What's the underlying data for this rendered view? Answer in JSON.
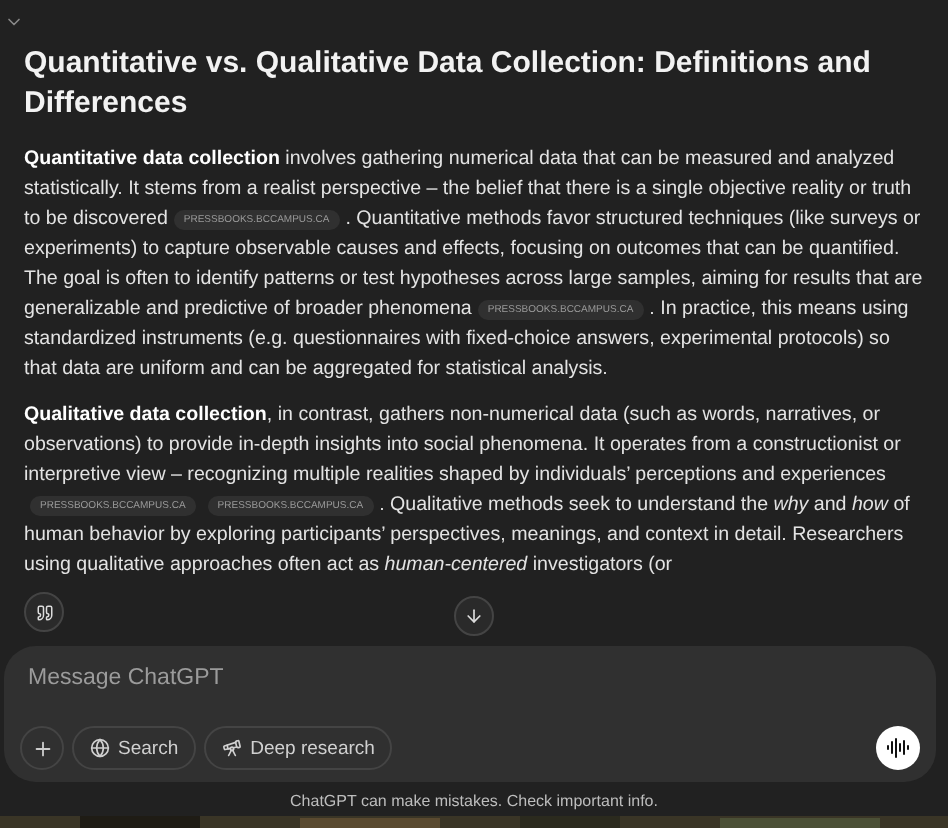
{
  "title": "Quantitative vs. Qualitative Data Collection: Definitions and Differences",
  "paragraphs": [
    {
      "segments": [
        {
          "kind": "text",
          "text": "**Quantitative data collection** involves gathering numerical data that can be measured and analyzed statistically. It stems from a realist perspective – the belief that there is a single objective reality or truth to be discovered"
        },
        {
          "kind": "citation",
          "label": "PRESSBOOKS.BCCAMPUS.CA"
        },
        {
          "kind": "text",
          "text": ". Quantitative methods favor structured techniques (like surveys or experiments) to capture observable causes and effects, focusing on outcomes that can be quantified. The goal is often to identify patterns or test hypotheses across large samples, aiming for results that are generalizable and predictive of broader phenomena"
        },
        {
          "kind": "citation",
          "label": "PRESSBOOKS.BCCAMPUS.CA"
        },
        {
          "kind": "text",
          "text": ". In practice, this means using standardized instruments (e.g. questionnaires with fixed-choice answers, experimental protocols) so that data are uniform and can be aggregated for statistical analysis."
        }
      ]
    },
    {
      "segments": [
        {
          "kind": "text",
          "text": "**Qualitative data collection**, in contrast, gathers non-numerical data (such as words, narratives, or observations) to provide in-depth insights into social phenomena. It operates from a constructionist or interpretive view – recognizing multiple realities shaped by individuals’ perceptions and experiences"
        },
        {
          "kind": "citation",
          "label": "PRESSBOOKS.BCCAMPUS.CA"
        },
        {
          "kind": "citation",
          "label": "PRESSBOOKS.BCCAMPUS.CA"
        },
        {
          "kind": "text",
          "text": ". Qualitative methods seek to understand the *why* and *how* of human behavior by exploring participants’ perspectives, meanings, and context in detail. Researchers using qualitative approaches often act as *human-centered* investigators (or"
        }
      ]
    }
  ],
  "composer": {
    "placeholder": "Message ChatGPT",
    "tools": [
      {
        "kind": "plus"
      },
      {
        "kind": "globe",
        "label": "Search"
      },
      {
        "kind": "telescope",
        "label": "Deep research"
      }
    ]
  },
  "disclaimer": "ChatGPT can make mistakes. Check important info."
}
